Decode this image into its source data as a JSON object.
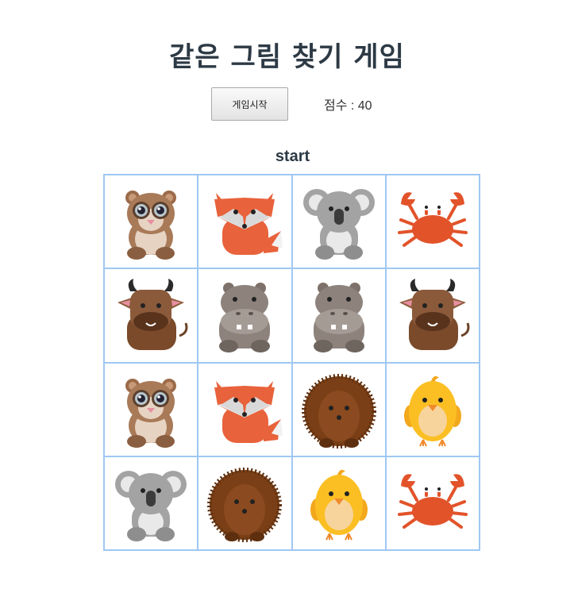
{
  "title": "같은 그림 찾기 게임",
  "controls": {
    "start_button_label": "게임시작",
    "score_label": "점수 : 40"
  },
  "status": "start",
  "board": {
    "rows": 4,
    "cols": 4,
    "cards": [
      "lemur",
      "fox",
      "koala",
      "crab",
      "bull",
      "hippo",
      "hippo",
      "bull",
      "lemur",
      "fox",
      "hedgehog",
      "chick",
      "koala",
      "hedgehog",
      "chick",
      "crab"
    ]
  },
  "colors": {
    "title": "#2d3a45",
    "grid_border": "#9fc8f3"
  }
}
